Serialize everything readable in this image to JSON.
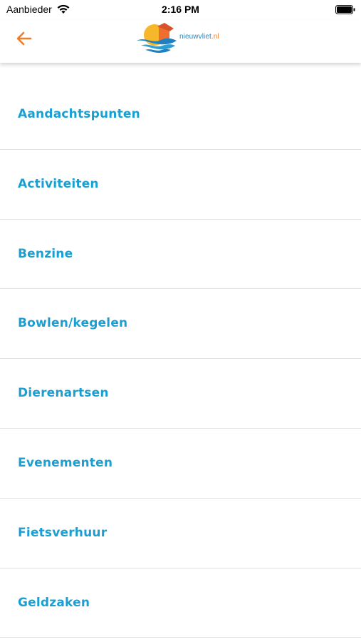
{
  "status_bar": {
    "carrier": "Aanbieder",
    "time": "2:16 PM"
  },
  "nav_bar": {
    "back_icon": "arrow-left-icon",
    "logo_text_main": "nieuwvliet",
    "logo_text_tld": ".nl"
  },
  "colors": {
    "accent_orange": "#f07d2a",
    "link_blue": "#1a9fd3",
    "logo_blue": "#2b86b9",
    "divider": "#e3e3e3"
  },
  "list": {
    "items": [
      {
        "label": "Aandachtspunten"
      },
      {
        "label": "Activiteiten"
      },
      {
        "label": "Benzine"
      },
      {
        "label": "Bowlen/kegelen"
      },
      {
        "label": "Dierenartsen"
      },
      {
        "label": "Evenementen"
      },
      {
        "label": "Fietsverhuur"
      },
      {
        "label": "Geldzaken"
      }
    ]
  }
}
